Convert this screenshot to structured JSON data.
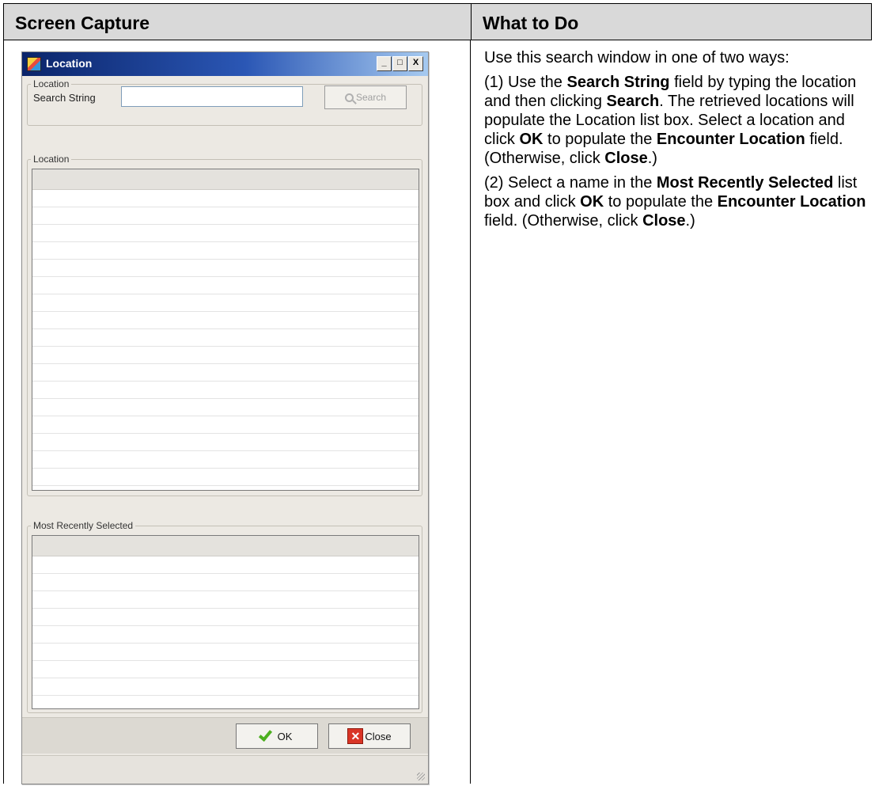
{
  "table": {
    "header_left": "Screen Capture",
    "header_right": "What to Do"
  },
  "dialog": {
    "title": "Location",
    "window_controls": [
      "_",
      "□",
      "X"
    ],
    "search_group_label": "Location",
    "search_label": "Search String",
    "search_value": "",
    "search_button": "Search",
    "location_group_label": "Location",
    "recent_group_label": "Most Recently Selected",
    "ok_button": "OK",
    "close_button": "Close",
    "close_icon_glyph": "✕"
  },
  "instructions": {
    "intro": "Use this search window in one of two ways:",
    "p1": {
      "s1": "(1) Use the ",
      "b1": "Search String",
      "s2": " field by typing the location and then clicking ",
      "b2": "Search",
      "s3": ". The retrieved locations will populate the Location list box. Select a location and click ",
      "b3": "OK",
      "s4": " to populate the ",
      "b4": "Encounter Location",
      "s5": " field. (Otherwise, click ",
      "b5": "Close",
      "s6": ".)"
    },
    "p2": {
      "s1": "(2) Select a name in the ",
      "b1": "Most Recently Selected",
      "s2": " list box and click ",
      "b2": "OK",
      "s3": " to populate the ",
      "b3": "Encounter Location",
      "s4": " field. (Otherwise, click ",
      "b4": "Close",
      "s5": ".)"
    }
  }
}
